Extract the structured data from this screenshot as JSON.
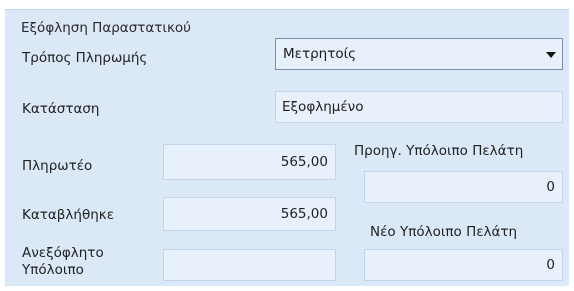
{
  "group": {
    "title": "Εξόφληση Παραστατικού"
  },
  "payment_method": {
    "label": "Τρόπος Πληρωμής",
    "value": "Μετρητοίς"
  },
  "status": {
    "label": "Κατάσταση",
    "value": "Εξοφλημένο"
  },
  "payable": {
    "label": "Πληρωτέο",
    "value": "565,00"
  },
  "paid": {
    "label": "Καταβλήθηκε",
    "value": "565,00"
  },
  "unpaid_balance": {
    "label_line1": "Ανεξόφλητο",
    "label_line2": "Υπόλοιπο",
    "value": ""
  },
  "prev_customer_balance": {
    "label": "Προηγ. Υπόλοιπο Πελάτη",
    "value": "0"
  },
  "new_customer_balance": {
    "label": "Νέο Υπόλοιπο Πελάτη",
    "value": "0"
  }
}
